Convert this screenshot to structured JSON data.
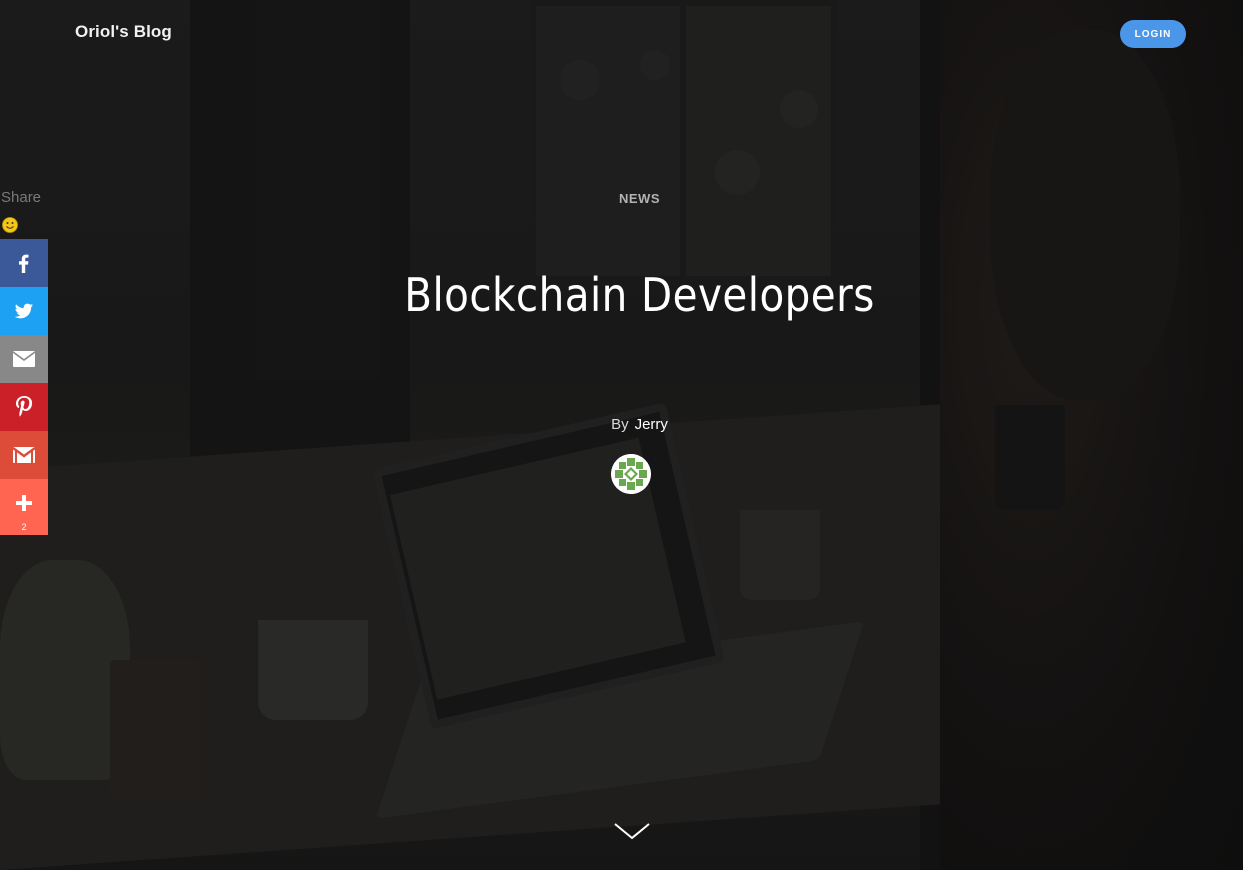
{
  "header": {
    "site_title": "Oriol's Blog",
    "login_label": "LOGIN"
  },
  "post": {
    "category": "NEWS",
    "title": "Blockchain Developers",
    "by_label": "By",
    "author": "Jerry"
  },
  "share": {
    "label": "Share",
    "buttons": [
      {
        "network": "facebook",
        "icon": "facebook-icon",
        "color": "#3b5998"
      },
      {
        "network": "twitter",
        "icon": "twitter-icon",
        "color": "#1da1f2"
      },
      {
        "network": "email",
        "icon": "email-icon",
        "color": "#888888"
      },
      {
        "network": "pinterest",
        "icon": "pinterest-icon",
        "color": "#cb2027"
      },
      {
        "network": "gmail",
        "icon": "gmail-icon",
        "color": "#dd4b39"
      },
      {
        "network": "more",
        "icon": "plus-icon",
        "color": "#ff6550",
        "count": "2"
      }
    ]
  },
  "colors": {
    "accent": "#4a97ea"
  }
}
